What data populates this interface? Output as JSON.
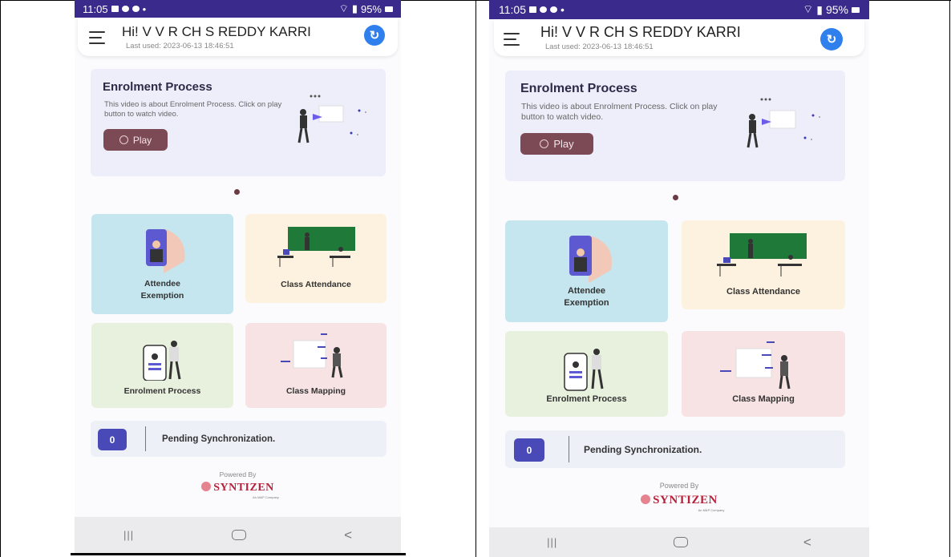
{
  "status_bar": {
    "time": "11:05",
    "battery": "95%"
  },
  "header": {
    "greeting": "Hi! V V R CH S REDDY KARRI",
    "last_used": "Last used: 2023-06-13 18:46:51"
  },
  "banner": {
    "title": "Enrolment Process",
    "description": "This video is about Enrolment Process. Click on play button to watch video.",
    "play_label": "Play"
  },
  "tiles": [
    {
      "label": "Attendee Exemption",
      "color": "#c5e6ee",
      "icon": "phone-user-icon"
    },
    {
      "label": "Class Attendance",
      "color": "#fdf2df",
      "icon": "classroom-icon"
    },
    {
      "label": "Enrolment Process",
      "color": "#e8f1de",
      "icon": "enrolment-icon"
    },
    {
      "label": "Class Mapping",
      "color": "#f7e3e3",
      "icon": "mapping-icon"
    }
  ],
  "pending": {
    "count": "0",
    "label": "Pending Synchronization."
  },
  "footer": {
    "powered_by": "Powered By",
    "brand": "SYNTIZEN",
    "brand_sub": "An M&P Company"
  },
  "colors": {
    "status_bar": "#3a2a8c",
    "sync_button": "#2f80ed",
    "play_button": "#7b4a55",
    "pending_badge": "#4a49b8",
    "brand": "#b8213a"
  }
}
